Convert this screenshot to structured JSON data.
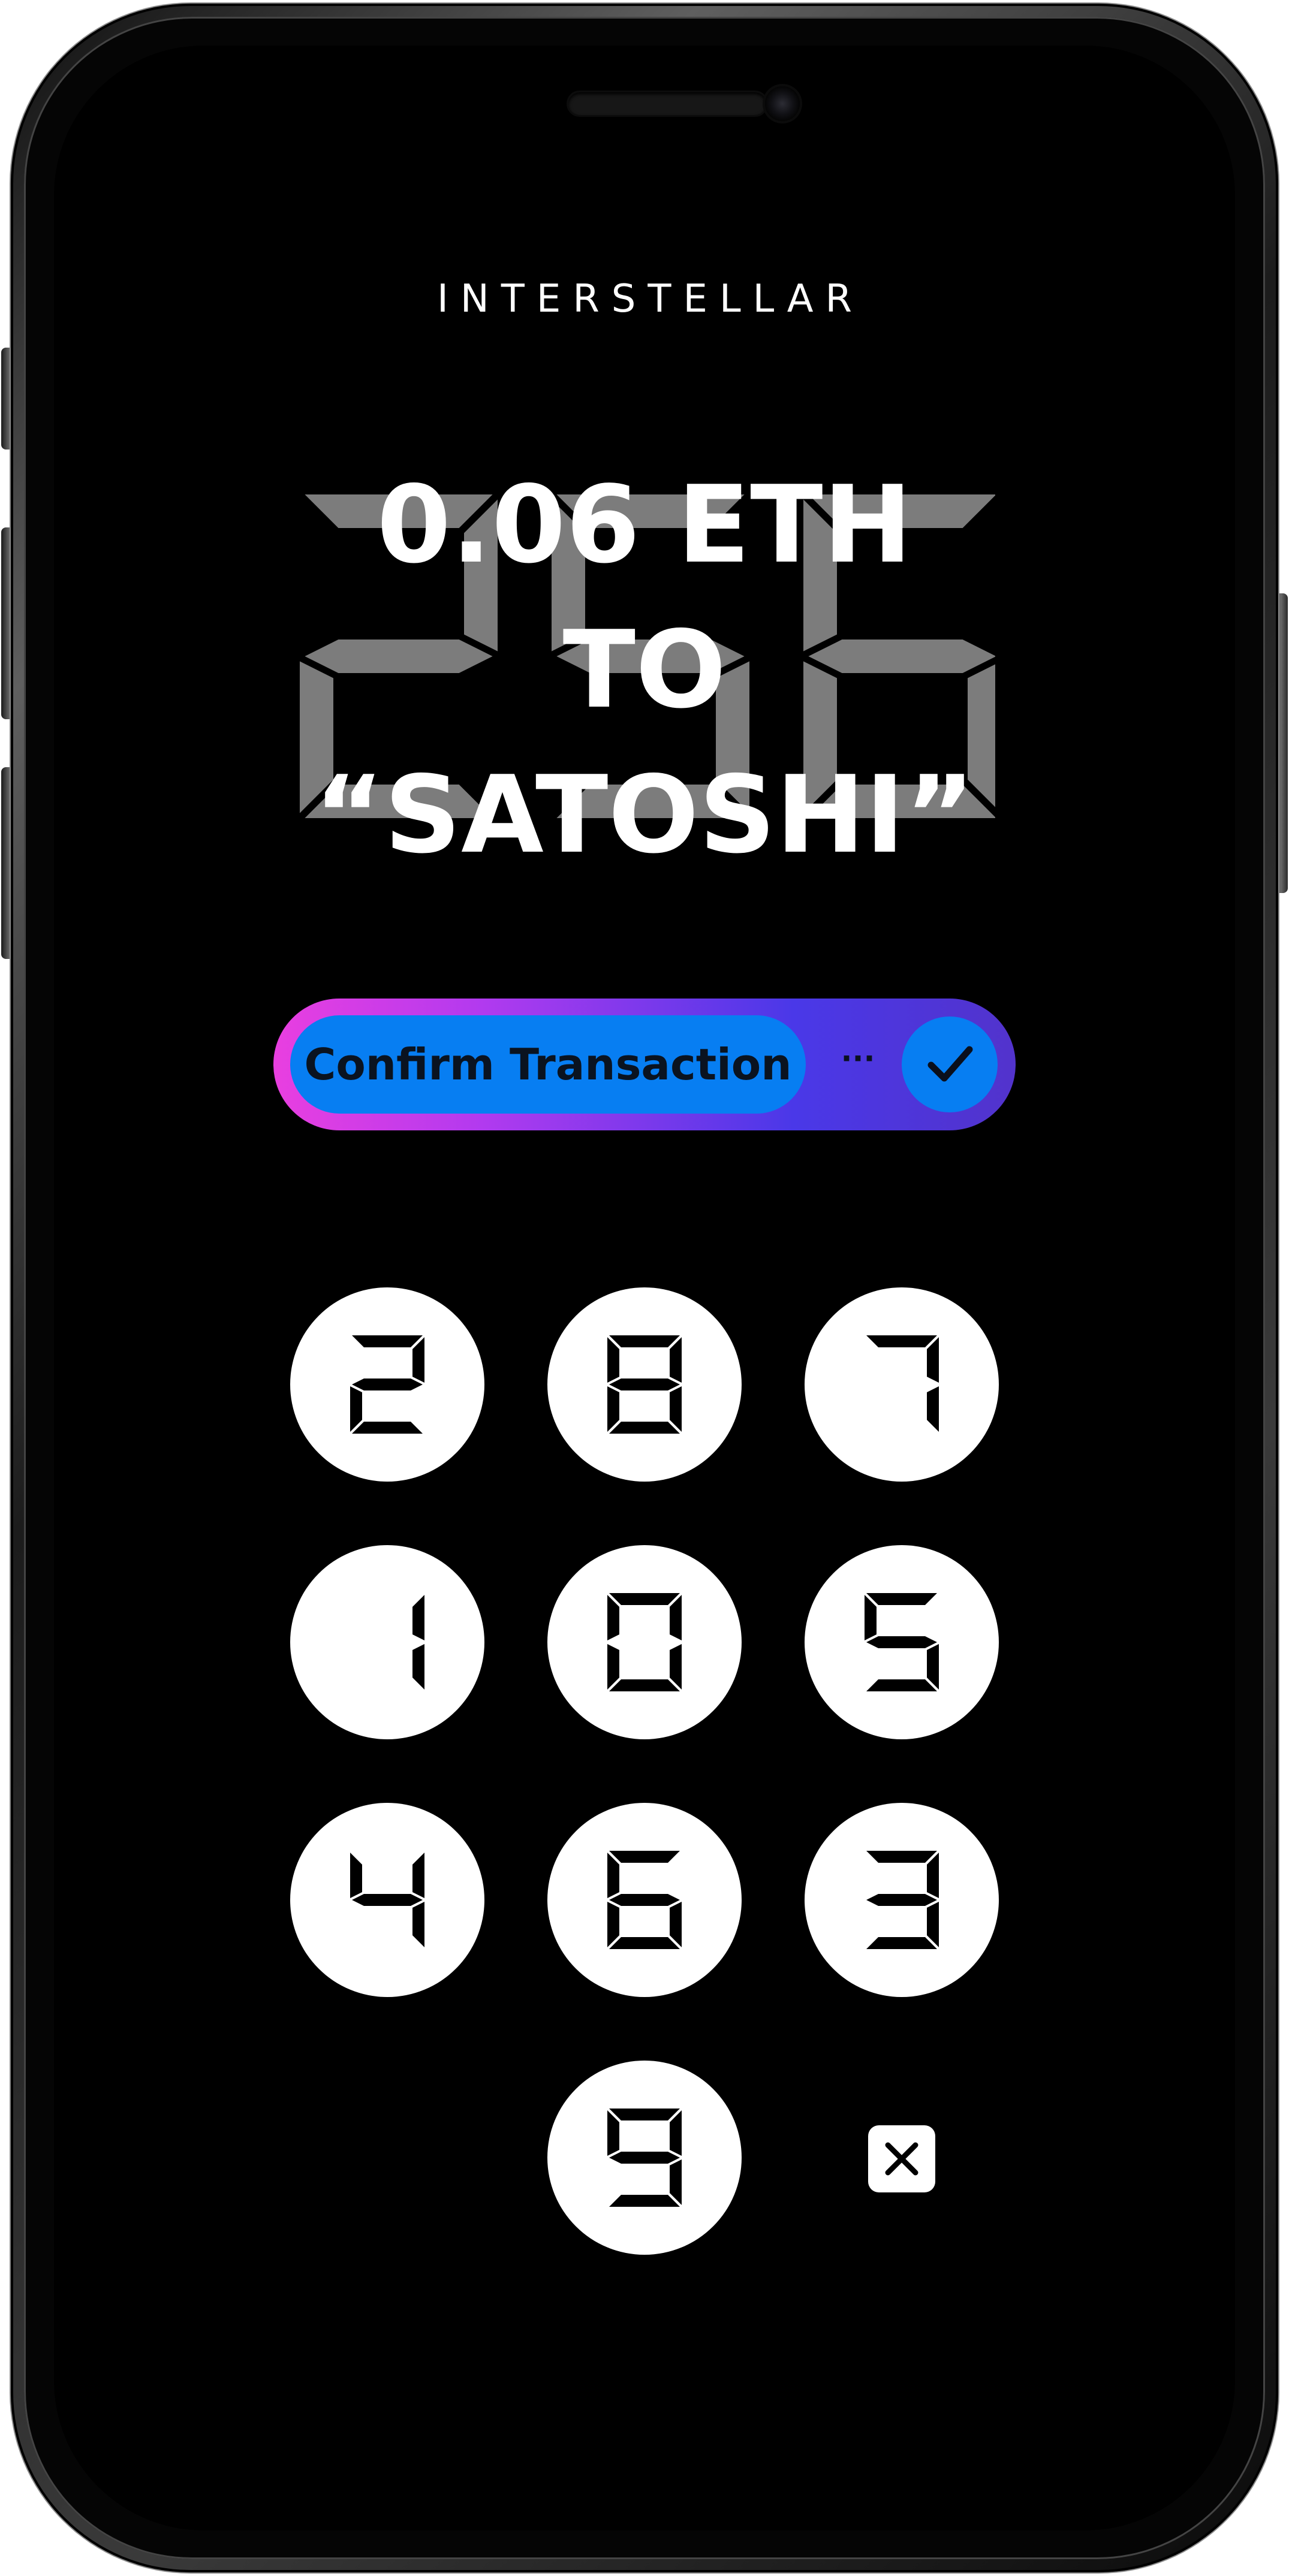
{
  "app": {
    "brand": "INTERSTELLAR"
  },
  "background_code": "256",
  "transaction": {
    "line1": "0.06 ETH",
    "line2": "TO",
    "line3": "“SATOSHI”"
  },
  "confirm": {
    "label": "Confirm Transaction",
    "dots": "···",
    "check_icon": "checkmark-icon",
    "gradient_colors": [
      "#e93fe0",
      "#4a38e8"
    ],
    "pill_color": "#077ef2"
  },
  "keypad": {
    "keys": [
      "2",
      "8",
      "7",
      "1",
      "0",
      "5",
      "4",
      "6",
      "3",
      "9"
    ],
    "delete_icon": "delete-x-icon"
  }
}
